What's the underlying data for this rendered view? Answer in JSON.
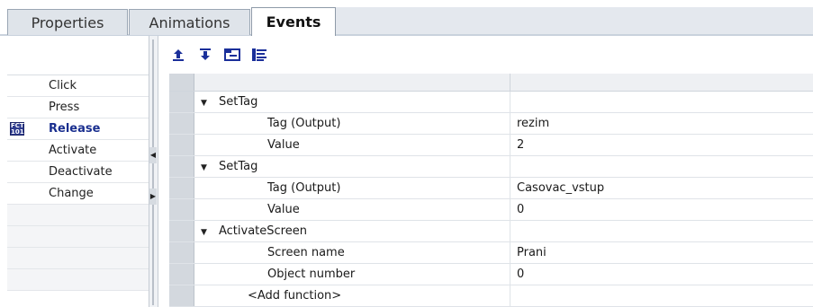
{
  "tabs": [
    {
      "label": "Properties",
      "active": false
    },
    {
      "label": "Animations",
      "active": false
    },
    {
      "label": "Events",
      "active": true
    }
  ],
  "events": {
    "items": [
      "Click",
      "Press",
      "Release",
      "Activate",
      "Deactivate",
      "Change"
    ],
    "selected": "Release",
    "selected_icon_text": "FCT\n101"
  },
  "toolbar": {
    "buttons": [
      "move-up",
      "move-down",
      "expand-all",
      "collapse-all"
    ]
  },
  "grid": {
    "rows": [
      {
        "kind": "function",
        "name": "SetTag",
        "value": ""
      },
      {
        "kind": "param",
        "name": "Tag (Output)",
        "value": "rezim"
      },
      {
        "kind": "param",
        "name": "Value",
        "value": "2"
      },
      {
        "kind": "function",
        "name": "SetTag",
        "value": ""
      },
      {
        "kind": "param",
        "name": "Tag (Output)",
        "value": "Casovac_vstup"
      },
      {
        "kind": "param",
        "name": "Value",
        "value": "0"
      },
      {
        "kind": "function",
        "name": "ActivateScreen",
        "value": ""
      },
      {
        "kind": "param",
        "name": "Screen name",
        "value": "Prani"
      },
      {
        "kind": "param",
        "name": "Object number",
        "value": "0"
      },
      {
        "kind": "add",
        "name": "<Add function>",
        "value": ""
      }
    ]
  },
  "colors": {
    "tab_bg": "#dfe4ea",
    "selected_event": "#1a2f8f",
    "row_header": "#d3d8de",
    "toolbar_icon": "#1a2f9a"
  }
}
